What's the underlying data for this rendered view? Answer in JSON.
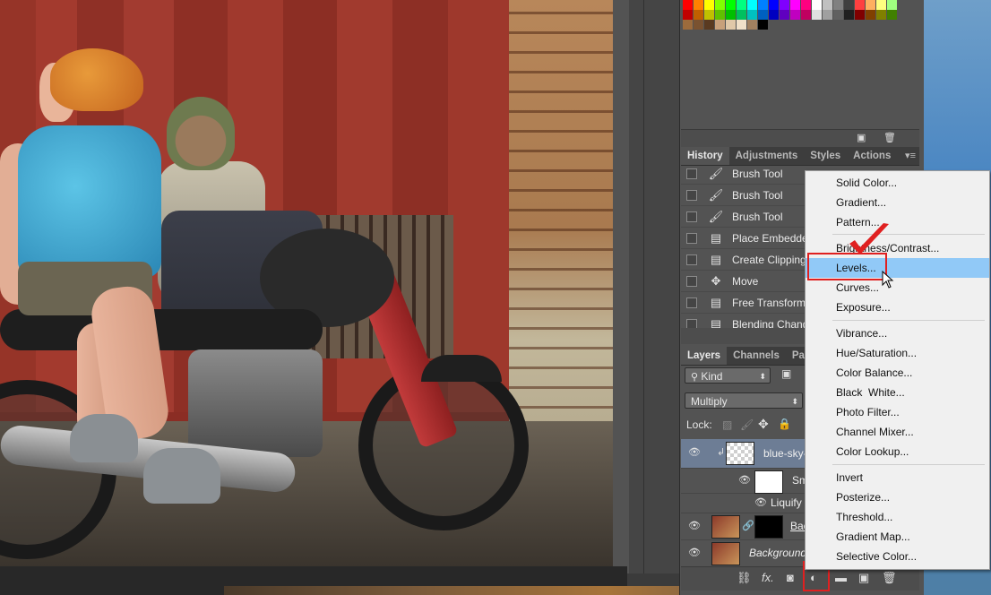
{
  "history_panel": {
    "tabs": [
      "History",
      "Adjustments",
      "Styles",
      "Actions"
    ],
    "items": [
      {
        "icon": "brush-icon",
        "label": "Brush Tool"
      },
      {
        "icon": "brush-icon",
        "label": "Brush Tool"
      },
      {
        "icon": "brush-icon",
        "label": "Brush Tool"
      },
      {
        "icon": "document-icon",
        "label": "Place Embedded"
      },
      {
        "icon": "document-icon",
        "label": "Create Clipping"
      },
      {
        "icon": "move-icon",
        "label": "Move"
      },
      {
        "icon": "document-icon",
        "label": "Free Transform"
      },
      {
        "icon": "document-icon",
        "label": "Blending Change"
      }
    ]
  },
  "layers_panel": {
    "tabs": [
      "Layers",
      "Channels",
      "Path"
    ],
    "filter_kind": "Kind",
    "blend_mode": "Multiply",
    "lock_label": "Lock:",
    "layers": [
      {
        "name": "blue-sky-",
        "selected": true
      },
      {
        "name": "Sm"
      },
      {
        "name": "Liquify"
      },
      {
        "name": "Bac"
      },
      {
        "name": "Background"
      }
    ],
    "footer_fx": "fx."
  },
  "adjustment_menu": {
    "groups": [
      [
        "Solid Color...",
        "Gradient...",
        "Pattern..."
      ],
      [
        "Brightness/Contrast...",
        "Levels...",
        "Curves...",
        "Exposure..."
      ],
      [
        "Vibrance...",
        "Hue/Saturation...",
        "Color Balance...",
        "Black  White...",
        "Photo Filter...",
        "Channel Mixer...",
        "Color Lookup..."
      ],
      [
        "Invert",
        "Posterize...",
        "Threshold...",
        "Gradient Map...",
        "Selective Color..."
      ]
    ],
    "highlighted": "Levels..."
  },
  "colors": {
    "menu_highlight": "#91c9f7",
    "annotation_red": "#e02020",
    "panel_bg": "#535353"
  }
}
